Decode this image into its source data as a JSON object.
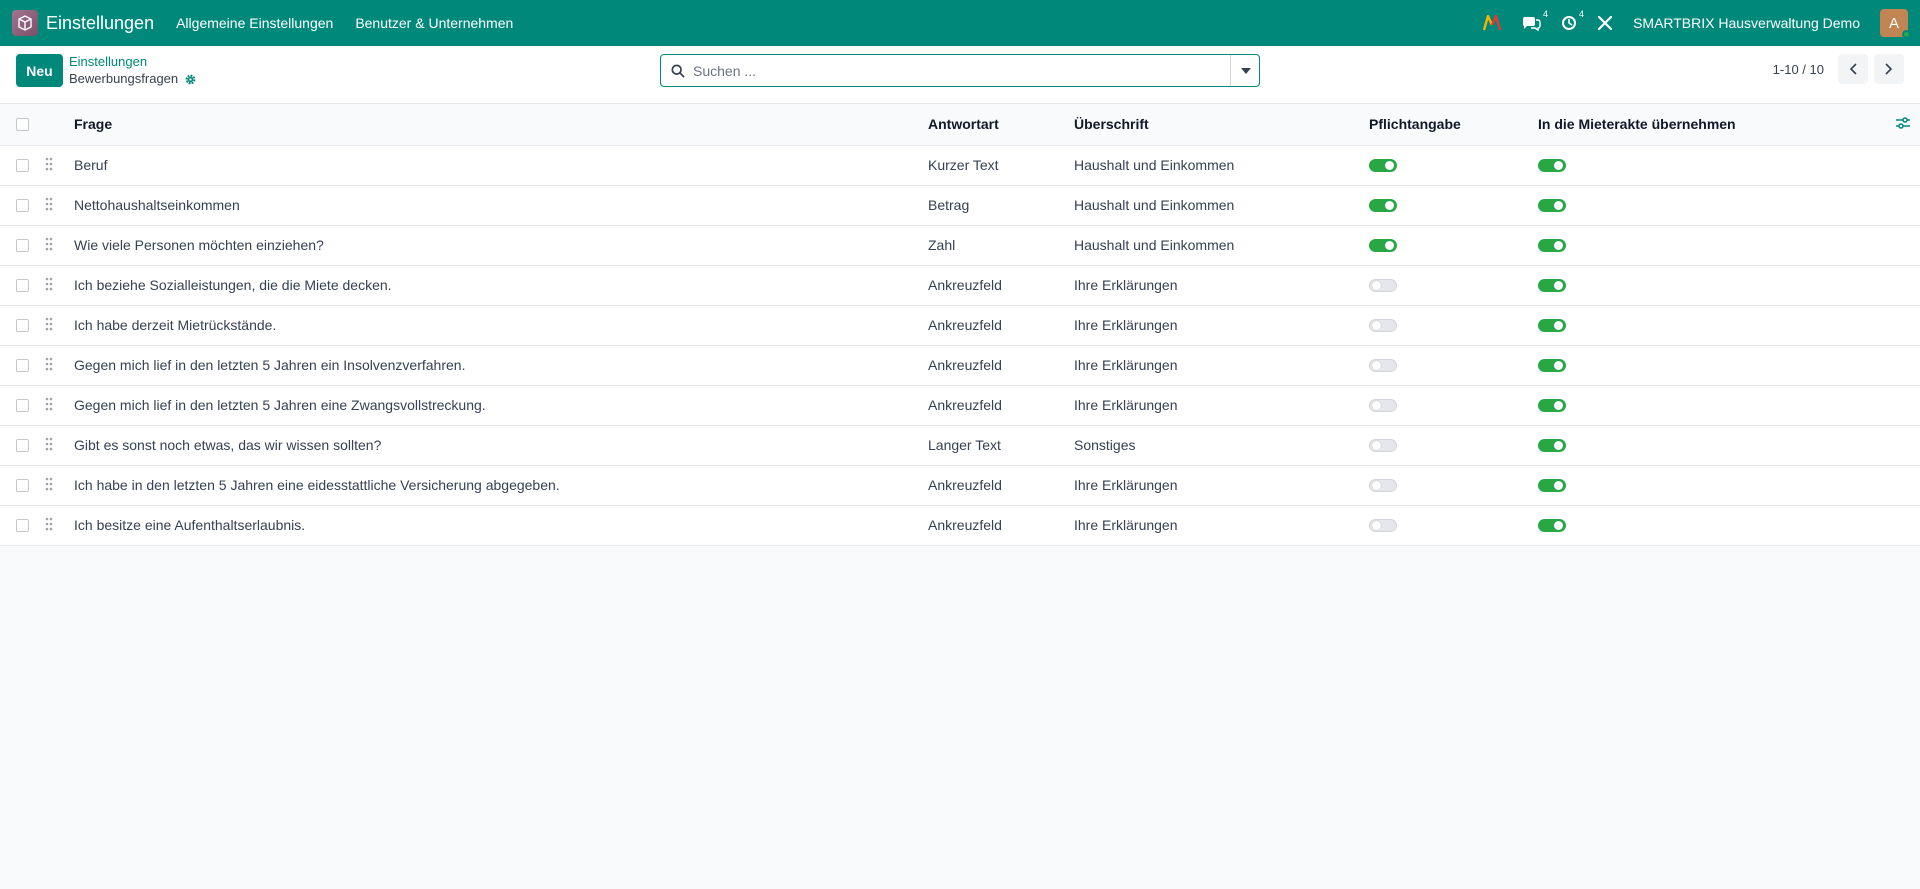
{
  "navbar": {
    "app_title": "Einstellungen",
    "menu": [
      "Allgemeine Einstellungen",
      "Benutzer & Unternehmen"
    ],
    "chat_count": "4",
    "activity_count": "4",
    "company": "SMARTBRIX Hausverwaltung Demo",
    "avatar_letter": "A",
    "brand_color": "#00897b"
  },
  "control_panel": {
    "new_label": "Neu",
    "breadcrumb_parent": "Einstellungen",
    "breadcrumb_current": "Bewerbungsfragen",
    "search_placeholder": "Suchen ...",
    "pager": "1-10 / 10"
  },
  "table": {
    "headers": {
      "frage": "Frage",
      "antwortart": "Antwortart",
      "ueberschrift": "Überschrift",
      "pflichtangabe": "Pflichtangabe",
      "mieterakte": "In die Mieterakte übernehmen"
    },
    "rows": [
      {
        "frage": "Beruf",
        "antwortart": "Kurzer Text",
        "ueberschrift": "Haushalt und Einkommen",
        "pflicht": true,
        "mieterakte": true
      },
      {
        "frage": "Nettohaushaltseinkommen",
        "antwortart": "Betrag",
        "ueberschrift": "Haushalt und Einkommen",
        "pflicht": true,
        "mieterakte": true
      },
      {
        "frage": "Wie viele Personen möchten einziehen?",
        "antwortart": "Zahl",
        "ueberschrift": "Haushalt und Einkommen",
        "pflicht": true,
        "mieterakte": true
      },
      {
        "frage": "Ich beziehe Sozialleistungen, die die Miete decken.",
        "antwortart": "Ankreuzfeld",
        "ueberschrift": "Ihre Erklärungen",
        "pflicht": false,
        "mieterakte": true
      },
      {
        "frage": "Ich habe derzeit Mietrückstände.",
        "antwortart": "Ankreuzfeld",
        "ueberschrift": "Ihre Erklärungen",
        "pflicht": false,
        "mieterakte": true
      },
      {
        "frage": "Gegen mich lief in den letzten 5 Jahren ein Insolvenzverfahren.",
        "antwortart": "Ankreuzfeld",
        "ueberschrift": "Ihre Erklärungen",
        "pflicht": false,
        "mieterakte": true
      },
      {
        "frage": "Gegen mich lief in den letzten 5 Jahren eine Zwangsvollstreckung.",
        "antwortart": "Ankreuzfeld",
        "ueberschrift": "Ihre Erklärungen",
        "pflicht": false,
        "mieterakte": true
      },
      {
        "frage": "Gibt es sonst noch etwas, das wir wissen sollten?",
        "antwortart": "Langer Text",
        "ueberschrift": "Sonstiges",
        "pflicht": false,
        "mieterakte": true
      },
      {
        "frage": "Ich habe in den letzten 5 Jahren eine eidesstattliche Versicherung abgegeben.",
        "antwortart": "Ankreuzfeld",
        "ueberschrift": "Ihre Erklärungen",
        "pflicht": false,
        "mieterakte": true
      },
      {
        "frage": "Ich besitze eine Aufenthaltserlaubnis.",
        "antwortart": "Ankreuzfeld",
        "ueberschrift": "Ihre Erklärungen",
        "pflicht": false,
        "mieterakte": true
      }
    ]
  }
}
